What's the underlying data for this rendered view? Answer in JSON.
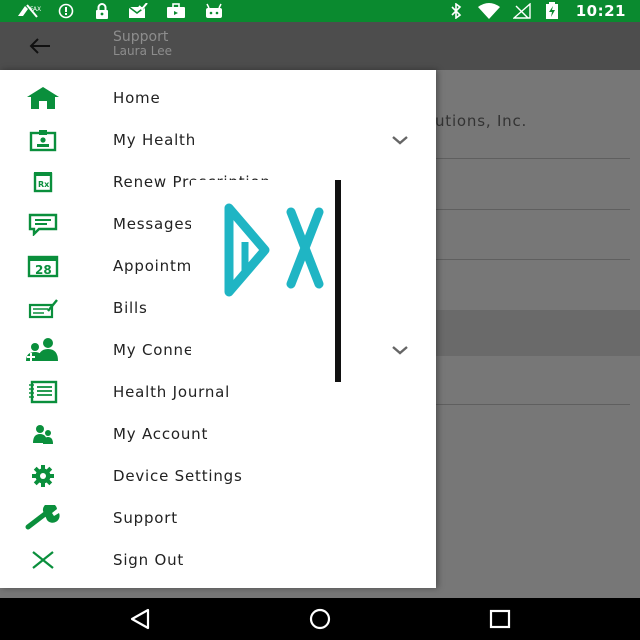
{
  "status_bar": {
    "time": "10:21",
    "left_icons": [
      "no-sim-icon",
      "info-circle-icon",
      "lock-icon",
      "mail-check-icon",
      "briefcase-icon",
      "android-icon"
    ],
    "right_icons": [
      "bluetooth-icon",
      "wifi-icon",
      "signal-icon",
      "battery-charging-icon"
    ],
    "bg_color": "#0a8a2f"
  },
  "app_bar": {
    "title": "Support",
    "subtitle": "Laura Lee"
  },
  "background": {
    "company_text": "lutions, Inc."
  },
  "drawer": {
    "accent_color": "#0a8f3c",
    "items": [
      {
        "label": "Home",
        "icon": "home-icon",
        "expandable": false
      },
      {
        "label": "My Health",
        "icon": "health-id-icon",
        "expandable": true
      },
      {
        "label": "Renew Prescription",
        "icon": "prescription-icon",
        "expandable": false
      },
      {
        "label": "Messages",
        "icon": "message-icon",
        "expandable": false
      },
      {
        "label": "Appointments",
        "icon": "calendar-icon",
        "calendar_day": "28",
        "expandable": false
      },
      {
        "label": "Bills",
        "icon": "bill-icon",
        "expandable": false
      },
      {
        "label": "My Connections",
        "icon": "connections-icon",
        "expandable": true
      },
      {
        "label": "Health Journal",
        "icon": "journal-icon",
        "expandable": false
      },
      {
        "label": "My Account",
        "icon": "account-icon",
        "expandable": false
      },
      {
        "label": "Device Settings",
        "icon": "gear-icon",
        "expandable": false
      },
      {
        "label": "Support",
        "icon": "wrench-icon",
        "expandable": false
      },
      {
        "label": "Sign Out",
        "icon": "close-icon",
        "expandable": false
      }
    ]
  },
  "overlay": {
    "glyphs": "DX",
    "color": "#1fb5c4"
  },
  "nav_bar": {
    "buttons": [
      "back-triangle-icon",
      "home-circle-icon",
      "recents-square-icon"
    ]
  }
}
